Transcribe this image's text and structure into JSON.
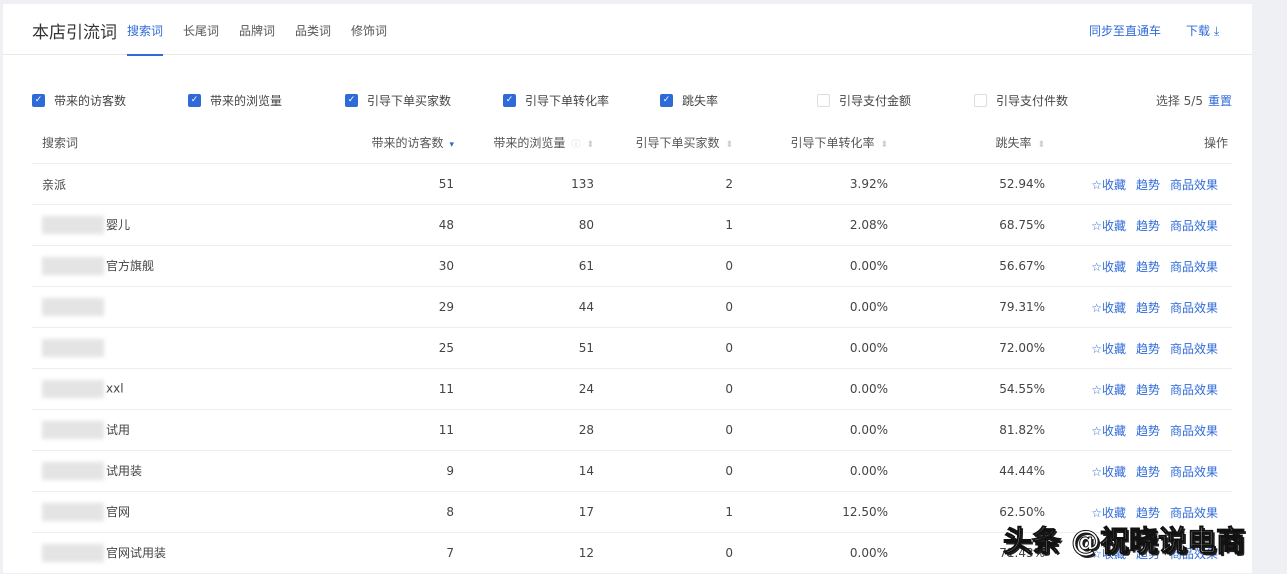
{
  "header": {
    "title": "本店引流词",
    "tabs": [
      "搜索词",
      "长尾词",
      "品牌词",
      "品类词",
      "修饰词"
    ],
    "active_tab": 0,
    "sync": "同步至直通车",
    "download": "下载 ⤓"
  },
  "metrics": [
    {
      "label": "带来的访客数",
      "checked": true
    },
    {
      "label": "带来的浏览量",
      "checked": true
    },
    {
      "label": "引导下单买家数",
      "checked": true
    },
    {
      "label": "引导下单转化率",
      "checked": true
    },
    {
      "label": "跳失率",
      "checked": true
    },
    {
      "label": "引导支付金额",
      "checked": false
    },
    {
      "label": "引导支付件数",
      "checked": false
    }
  ],
  "selection": {
    "text": "选择 5/5",
    "reset": "重置"
  },
  "columns": [
    "搜索词",
    "带来的访客数",
    "带来的浏览量",
    "引导下单买家数",
    "引导下单转化率",
    "跳失率",
    "操作"
  ],
  "actions": [
    "☆收藏",
    "趋势",
    "商品效果"
  ],
  "rows": [
    {
      "kw": "亲派",
      "v": "51",
      "pv": "133",
      "b": "2",
      "cr": "3.92%",
      "br": "52.94%"
    },
    {
      "kw": "婴儿",
      "v": "48",
      "pv": "80",
      "b": "1",
      "cr": "2.08%",
      "br": "68.75%"
    },
    {
      "kw": "官方旗舰",
      "v": "30",
      "pv": "61",
      "b": "0",
      "cr": "0.00%",
      "br": "56.67%"
    },
    {
      "kw": "",
      "v": "29",
      "pv": "44",
      "b": "0",
      "cr": "0.00%",
      "br": "79.31%"
    },
    {
      "kw": "",
      "v": "25",
      "pv": "51",
      "b": "0",
      "cr": "0.00%",
      "br": "72.00%"
    },
    {
      "kw": "xxl",
      "v": "11",
      "pv": "24",
      "b": "0",
      "cr": "0.00%",
      "br": "54.55%"
    },
    {
      "kw": "试用",
      "v": "11",
      "pv": "28",
      "b": "0",
      "cr": "0.00%",
      "br": "81.82%"
    },
    {
      "kw": "试用装",
      "v": "9",
      "pv": "14",
      "b": "0",
      "cr": "0.00%",
      "br": "44.44%"
    },
    {
      "kw": "官网",
      "v": "8",
      "pv": "17",
      "b": "1",
      "cr": "12.50%",
      "br": "62.50%"
    },
    {
      "kw": "官网试用装",
      "v": "7",
      "pv": "12",
      "b": "0",
      "cr": "0.00%",
      "br": "71.43%"
    }
  ],
  "watermark": "头条 @祝晓说电商"
}
